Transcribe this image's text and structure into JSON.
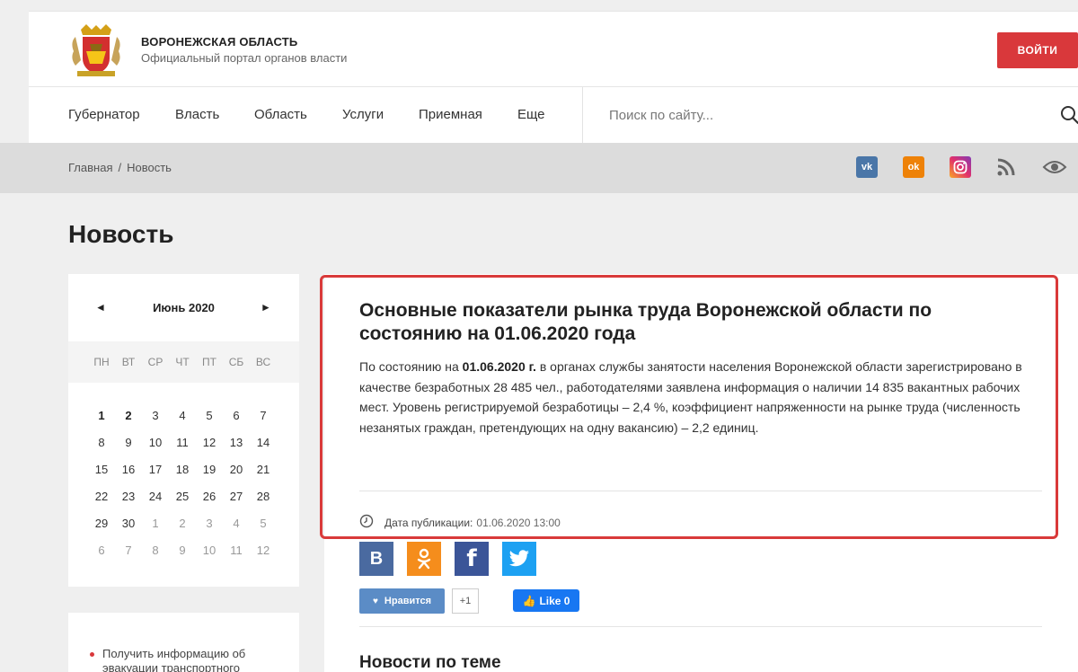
{
  "header": {
    "site_name": "ВОРОНЕЖСКАЯ ОБЛАСТЬ",
    "site_sub": "Официальный портал органов власти",
    "login_label": "ВОЙТИ",
    "logo_icon": "coat-of-arms"
  },
  "nav": {
    "items": [
      "Губернатор",
      "Власть",
      "Область",
      "Услуги",
      "Приемная",
      "Еще"
    ],
    "search_placeholder": "Поиск по сайту..."
  },
  "breadcrumbs": {
    "home": "Главная",
    "sep": "/",
    "current": "Новость"
  },
  "social": {
    "vk": "vk",
    "ok": "ok"
  },
  "page_title": "Новость",
  "calendar": {
    "prev": "◄",
    "next": "►",
    "month": "Июнь 2020",
    "dow": [
      "ПН",
      "ВТ",
      "СР",
      "ЧТ",
      "ПТ",
      "СБ",
      "ВС"
    ],
    "weeks": [
      [
        "1",
        "2",
        "3",
        "4",
        "5",
        "6",
        "7"
      ],
      [
        "8",
        "9",
        "10",
        "11",
        "12",
        "13",
        "14"
      ],
      [
        "15",
        "16",
        "17",
        "18",
        "19",
        "20",
        "21"
      ],
      [
        "22",
        "23",
        "24",
        "25",
        "26",
        "27",
        "28"
      ],
      [
        "29",
        "30",
        "1",
        "2",
        "3",
        "4",
        "5"
      ],
      [
        "6",
        "7",
        "8",
        "9",
        "10",
        "11",
        "12"
      ]
    ]
  },
  "side": {
    "link": "Получить информацию об эвакуации транспортного"
  },
  "article": {
    "title": "Основные показатели рынка труда Воронежской области по состоянию на 01.06.2020 года",
    "body_pre": "По состоянию на ",
    "body_bold": "01.06.2020 г.",
    "body_post": " в органах службы занятости населения Воронежской области зарегистрировано в качестве безработных 28 485 чел., работодателями заявлена информация о наличии 14 835 вакантных  рабочих  мест. Уровень регистрируемой безработицы – 2,4 %, коэффициент напряженности на рынке труда (численность незанятых граждан, претендующих на одну вакансию) – 2,2 единиц.",
    "date_label": "Дата публикации:",
    "date_value": "01.06.2020 13:00"
  },
  "share": {
    "vk": "В",
    "ok": "ок",
    "fb": "f",
    "tw": "tw"
  },
  "likes": {
    "like_label": "Нравится",
    "like_count": "+1",
    "fb_like": "Like 0"
  },
  "related": {
    "title": "Новости по теме"
  }
}
